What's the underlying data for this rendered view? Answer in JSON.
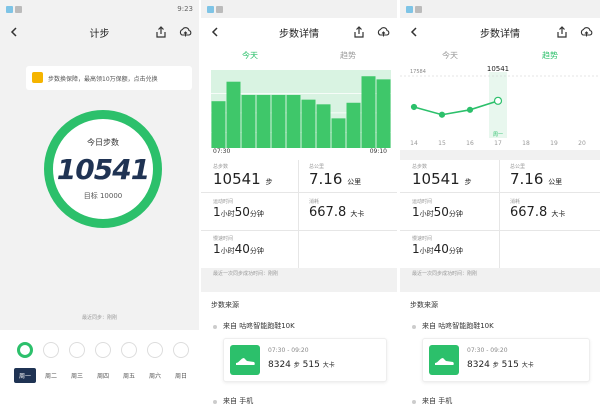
{
  "status": {
    "time": "9:23"
  },
  "colors": {
    "accent": "#2cc06b",
    "navy": "#1f3353",
    "bar": "#3fc76a",
    "bar_bg": "#d9f3e2"
  },
  "panel1": {
    "title": "计步",
    "banner": "步数换保障，最高领10万保额，点击兑换",
    "ring_label": "今日步数",
    "steps": "10541",
    "goal": "目标 10000",
    "last_sync": "最近同步：刚刚",
    "week": [
      "周一",
      "周二",
      "周三",
      "周四",
      "周五",
      "周六",
      "周日"
    ],
    "selected_day": 0
  },
  "panel2": {
    "title": "步数详情",
    "tabs": [
      "今天",
      "趋势"
    ],
    "active_tab": 0,
    "time_start": "07:30",
    "time_end": "09:10",
    "chart_data": {
      "type": "bar",
      "values": [
        60,
        85,
        68,
        68,
        68,
        68,
        62,
        56,
        38,
        58,
        92,
        88
      ],
      "ylim": [
        0,
        100
      ]
    },
    "steps_label": "总步数",
    "steps": "10541",
    "steps_unit": "步",
    "dist_label": "总公里",
    "dist": "7.16",
    "dist_unit": "公里",
    "dur_label": "运动时间",
    "dur_h": "1",
    "dur_h_unit": "小时",
    "dur_m": "50",
    "dur_m_unit": "分钟",
    "cal_label": "消耗",
    "cal": "667.8",
    "cal_unit": "大卡",
    "slow_label": "慢速时间",
    "slow_h": "1",
    "slow_h_unit": "小时",
    "slow_m": "40",
    "slow_m_unit": "分钟",
    "sync_note": "最近一次同步成功时间：刚刚",
    "source_title": "步数来源",
    "source_device": "来自 咕咚智能跑鞋10K",
    "record_time": "07:30 - 09:20",
    "record_steps": "8324",
    "record_steps_unit": "步",
    "record_cal": "515",
    "record_cal_unit": "大卡",
    "source_phone": "来自 手机"
  },
  "panel3": {
    "title": "步数详情",
    "tabs": [
      "今天",
      "趋势"
    ],
    "active_tab": 1,
    "max_label": "17584",
    "current_label": "10541",
    "dates": [
      "14",
      "15",
      "16",
      "17",
      "18",
      "19",
      "20"
    ],
    "selected_label": "周一",
    "chart_data": {
      "type": "line",
      "x": [
        "14",
        "15",
        "16",
        "17"
      ],
      "values": [
        8800,
        6600,
        8000,
        10541
      ],
      "ylim": [
        0,
        17584
      ]
    }
  }
}
